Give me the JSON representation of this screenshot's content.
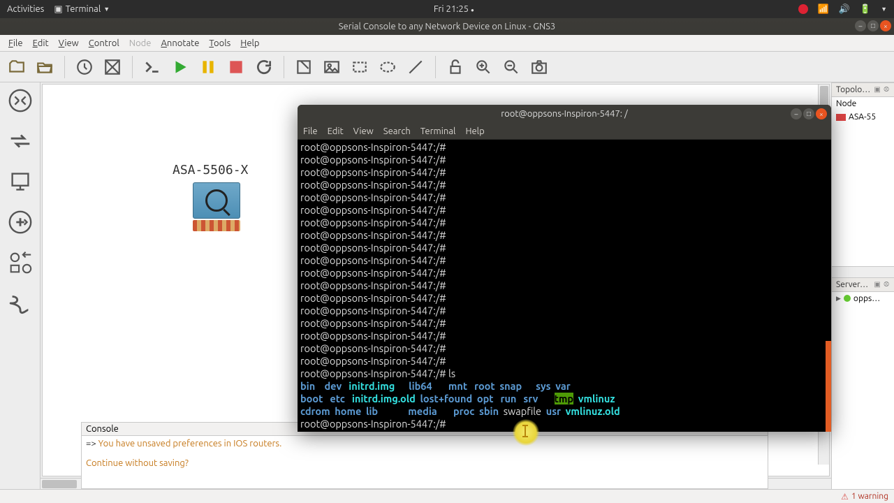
{
  "sysbar": {
    "activities": "Activities",
    "terminal_app": "Terminal",
    "clock": "Fri 21:25"
  },
  "app": {
    "title": "Serial Console to any Network Device on Linux - GNS3"
  },
  "menu": {
    "file": "File",
    "edit": "Edit",
    "view": "View",
    "control": "Control",
    "node": "Node",
    "annotate": "Annotate",
    "tools": "Tools",
    "help": "Help"
  },
  "device": {
    "label": "ASA-5506-X"
  },
  "console": {
    "title": "Console",
    "prefix": "=> ",
    "line1": "You have unsaved preferences in IOS routers.",
    "line2": "Continue without saving?"
  },
  "right": {
    "topology": "Topolo…",
    "node": "Node",
    "asa": "ASA-55",
    "servers": "Server…",
    "server_name": "opps…"
  },
  "terminal": {
    "title": "root@oppsons-Inspiron-5447: /",
    "menu": {
      "file": "File",
      "edit": "Edit",
      "view": "View",
      "search": "Search",
      "terminal": "Terminal",
      "help": "Help"
    },
    "prompt": "root@oppsons-Inspiron-5447:/#",
    "cmd_ls": "ls",
    "ls": {
      "bin": "bin",
      "dev": "dev",
      "initrd_img": "initrd.img",
      "lib64": "lib64",
      "mnt": "mnt",
      "root": "root",
      "snap": "snap",
      "sys": "sys",
      "var": "var",
      "boot": "boot",
      "etc": "etc",
      "initrd_img_old": "initrd.img.old",
      "lostfound": "lost+found",
      "opt": "opt",
      "run": "run",
      "srv": "srv",
      "tmp": "tmp",
      "vmlinuz": "vmlinuz",
      "cdrom": "cdrom",
      "home": "home",
      "lib": "lib",
      "media": "media",
      "proc": "proc",
      "sbin": "sbin",
      "swapfile": "swapfile",
      "usr": "usr",
      "vmlinuz_old": "vmlinuz.old"
    }
  },
  "status": {
    "warning": "1 warning"
  }
}
